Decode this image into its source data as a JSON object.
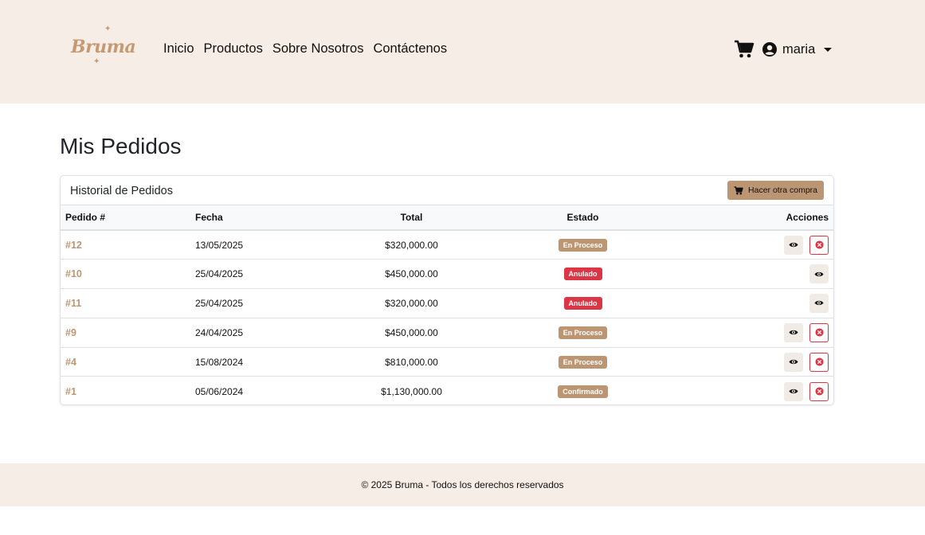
{
  "brand": {
    "logo_text": "Bruma",
    "accent": "#bc9573",
    "header_bg": "#f5ede6"
  },
  "nav": {
    "items": [
      {
        "label": "Inicio"
      },
      {
        "label": "Productos"
      },
      {
        "label": "Sobre Nosotros"
      },
      {
        "label": "Contáctenos"
      }
    ]
  },
  "user": {
    "name": "maria",
    "icon": "user-circle-icon"
  },
  "cart": {
    "icon": "cart-icon"
  },
  "page": {
    "title": "Mis Pedidos"
  },
  "card": {
    "title": "Historial de Pedidos",
    "new_order_button": "Hacer otra compra"
  },
  "table": {
    "headers": {
      "id": "Pedido #",
      "date": "Fecha",
      "total": "Total",
      "state": "Estado",
      "actions": "Acciones"
    },
    "rows": [
      {
        "id": "#12",
        "date": "13/05/2025",
        "total": "$320,000.00",
        "state": "En Proceso",
        "state_color": "#bc9573",
        "can_cancel": true
      },
      {
        "id": "#10",
        "date": "25/04/2025",
        "total": "$450,000.00",
        "state": "Anulado",
        "state_color": "#dc3545",
        "can_cancel": false
      },
      {
        "id": "#11",
        "date": "25/04/2025",
        "total": "$320,000.00",
        "state": "Anulado",
        "state_color": "#dc3545",
        "can_cancel": false
      },
      {
        "id": "#9",
        "date": "24/04/2025",
        "total": "$450,000.00",
        "state": "En Proceso",
        "state_color": "#bc9573",
        "can_cancel": true
      },
      {
        "id": "#4",
        "date": "15/08/2024",
        "total": "$810,000.00",
        "state": "En Proceso",
        "state_color": "#bc9573",
        "can_cancel": true
      },
      {
        "id": "#1",
        "date": "05/06/2024",
        "total": "$1,130,000.00",
        "state": "Confirmado",
        "state_color": "#bc9573",
        "can_cancel": true
      }
    ]
  },
  "footer": {
    "text": "© 2025 Bruma - Todos los derechos reservados"
  }
}
